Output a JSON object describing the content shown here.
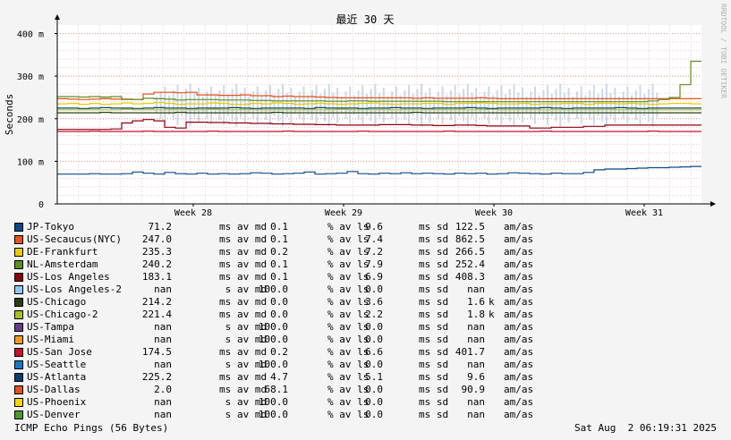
{
  "chart_data": {
    "type": "line",
    "title": "最近 30 天",
    "ylabel": "Seconds",
    "ylim": [
      0,
      0.42
    ],
    "y_ticks": [
      {
        "value": 0,
        "label": "0"
      },
      {
        "value": 0.1,
        "label": "100 m"
      },
      {
        "value": 0.2,
        "label": "200 m"
      },
      {
        "value": 0.3,
        "label": "300 m"
      },
      {
        "value": 0.4,
        "label": "400 m"
      }
    ],
    "x_ticks": [
      "Week 28",
      "Week 29",
      "Week 30",
      "Week 31"
    ],
    "grid": true,
    "watermark": "RRDTOOL / TOBI OETIKER",
    "series": [
      {
        "name": "JP-Tokyo",
        "color": "#0b4a8a",
        "values": [
          0.07,
          0.07,
          0.07,
          0.071,
          0.07,
          0.07,
          0.071,
          0.075,
          0.072,
          0.07,
          0.074,
          0.071,
          0.07,
          0.072,
          0.07,
          0.071,
          0.07,
          0.071,
          0.073,
          0.072,
          0.07,
          0.071,
          0.072,
          0.075,
          0.07,
          0.071,
          0.072,
          0.076,
          0.071,
          0.07,
          0.072,
          0.071,
          0.073,
          0.071,
          0.072,
          0.071,
          0.07,
          0.072,
          0.071,
          0.072,
          0.07,
          0.071,
          0.073,
          0.072,
          0.071,
          0.07,
          0.072,
          0.071,
          0.071,
          0.074,
          0.08,
          0.082,
          0.082,
          0.083,
          0.084,
          0.085,
          0.085,
          0.086,
          0.087,
          0.088
        ]
      },
      {
        "name": "US-Secaucus(NYC)",
        "color": "#e8511c",
        "values": [
          0.247,
          0.246,
          0.245,
          0.246,
          0.247,
          0.246,
          0.246,
          0.245,
          0.258,
          0.262,
          0.262,
          0.261,
          0.262,
          0.256,
          0.256,
          0.255,
          0.255,
          0.256,
          0.254,
          0.254,
          0.252,
          0.253,
          0.252,
          0.252,
          0.251,
          0.25,
          0.249,
          0.249,
          0.249,
          0.249,
          0.249,
          0.249,
          0.249,
          0.248,
          0.249,
          0.248,
          0.248,
          0.248,
          0.248,
          0.249,
          0.248,
          0.247,
          0.247,
          0.247,
          0.247,
          0.247,
          0.247,
          0.247,
          0.247,
          0.247,
          0.247,
          0.247,
          0.247,
          0.247,
          0.247,
          0.247,
          0.247,
          0.247,
          0.247,
          0.247
        ]
      },
      {
        "name": "DE-Frankfurt",
        "color": "#e8cc00",
        "values": [
          0.235,
          0.236,
          0.234,
          0.236,
          0.234,
          0.235,
          0.237,
          0.235,
          0.236,
          0.238,
          0.236,
          0.234,
          0.235,
          0.235,
          0.237,
          0.236,
          0.234,
          0.234,
          0.236,
          0.235,
          0.237,
          0.236,
          0.234,
          0.235,
          0.236,
          0.235,
          0.234,
          0.235,
          0.236,
          0.237,
          0.235,
          0.234,
          0.235,
          0.235,
          0.236,
          0.236,
          0.234,
          0.236,
          0.236,
          0.237,
          0.236,
          0.235,
          0.235,
          0.236,
          0.234,
          0.235,
          0.235,
          0.236,
          0.236,
          0.234,
          0.236,
          0.236,
          0.235,
          0.236,
          0.235,
          0.234,
          0.235,
          0.236,
          0.236,
          0.235
        ]
      },
      {
        "name": "NL-Amsterdam",
        "color": "#5b8f22",
        "values": [
          0.252,
          0.252,
          0.251,
          0.252,
          0.251,
          0.252,
          0.245,
          0.245,
          0.248,
          0.247,
          0.246,
          0.244,
          0.245,
          0.245,
          0.245,
          0.244,
          0.244,
          0.244,
          0.243,
          0.243,
          0.242,
          0.242,
          0.242,
          0.242,
          0.242,
          0.241,
          0.241,
          0.242,
          0.242,
          0.241,
          0.241,
          0.241,
          0.241,
          0.241,
          0.241,
          0.241,
          0.24,
          0.24,
          0.24,
          0.24,
          0.24,
          0.24,
          0.24,
          0.24,
          0.24,
          0.24,
          0.24,
          0.24,
          0.24,
          0.24,
          0.24,
          0.24,
          0.24,
          0.24,
          0.24,
          0.242,
          0.245,
          0.25,
          0.28,
          0.335
        ]
      },
      {
        "name": "US-Los Angeles",
        "color": "#8b0010",
        "values": [
          0.175,
          0.175,
          0.175,
          0.175,
          0.175,
          0.176,
          0.19,
          0.195,
          0.198,
          0.195,
          0.18,
          0.178,
          0.192,
          0.192,
          0.191,
          0.191,
          0.19,
          0.19,
          0.189,
          0.189,
          0.188,
          0.188,
          0.187,
          0.187,
          0.186,
          0.186,
          0.185,
          0.185,
          0.185,
          0.185,
          0.186,
          0.186,
          0.186,
          0.185,
          0.185,
          0.184,
          0.184,
          0.185,
          0.185,
          0.184,
          0.183,
          0.183,
          0.183,
          0.183,
          0.178,
          0.178,
          0.18,
          0.18,
          0.18,
          0.182,
          0.182,
          0.185,
          0.185,
          0.185,
          0.185,
          0.185,
          0.185,
          0.185,
          0.185,
          0.185
        ]
      },
      {
        "name": "US-Los Angeles-2",
        "color": "#8ec7ef",
        "values": [
          null
        ]
      },
      {
        "name": "US-Chicago",
        "color": "#2c3d12",
        "values": [
          0.214,
          0.214,
          0.214,
          0.214,
          0.215,
          0.214,
          0.214,
          0.214,
          0.214,
          0.214,
          0.214,
          0.215,
          0.214,
          0.214,
          0.214,
          0.214,
          0.214,
          0.214,
          0.214,
          0.214,
          0.215,
          0.214,
          0.214,
          0.214,
          0.214,
          0.214,
          0.214,
          0.214,
          0.214,
          0.214,
          0.214,
          0.214,
          0.214,
          0.215,
          0.214,
          0.214,
          0.214,
          0.214,
          0.214,
          0.214,
          0.214,
          0.214,
          0.214,
          0.214,
          0.214,
          0.214,
          0.214,
          0.214,
          0.214,
          0.214,
          0.214,
          0.214,
          0.214,
          0.214,
          0.214,
          0.214,
          0.214,
          0.214,
          0.214,
          0.214
        ]
      },
      {
        "name": "US-Chicago-2",
        "color": "#a8c21a",
        "values": [
          0.221,
          0.221,
          0.221,
          0.221,
          0.221,
          0.221,
          0.222,
          0.221,
          0.221,
          0.221,
          0.221,
          0.221,
          0.221,
          0.221,
          0.222,
          0.221,
          0.221,
          0.221,
          0.221,
          0.221,
          0.221,
          0.221,
          0.221,
          0.221,
          0.221,
          0.221,
          0.222,
          0.221,
          0.221,
          0.221,
          0.221,
          0.221,
          0.221,
          0.221,
          0.221,
          0.221,
          0.221,
          0.221,
          0.221,
          0.221,
          0.222,
          0.221,
          0.221,
          0.221,
          0.221,
          0.221,
          0.221,
          0.221,
          0.221,
          0.221,
          0.221,
          0.221,
          0.221,
          0.221,
          0.221,
          0.221,
          0.221,
          0.221,
          0.221,
          0.221
        ]
      },
      {
        "name": "US-Tampa",
        "color": "#6a3a8a",
        "values": [
          null
        ]
      },
      {
        "name": "US-Miami",
        "color": "#f39a1c",
        "values": [
          null
        ]
      },
      {
        "name": "US-San Jose",
        "color": "#c8102e",
        "values": [
          0.17,
          0.17,
          0.17,
          0.171,
          0.17,
          0.17,
          0.17,
          0.17,
          0.171,
          0.17,
          0.17,
          0.17,
          0.17,
          0.17,
          0.171,
          0.17,
          0.17,
          0.17,
          0.17,
          0.17,
          0.17,
          0.171,
          0.17,
          0.17,
          0.17,
          0.17,
          0.17,
          0.17,
          0.171,
          0.17,
          0.17,
          0.17,
          0.17,
          0.17,
          0.17,
          0.17,
          0.171,
          0.17,
          0.17,
          0.17,
          0.17,
          0.17,
          0.17,
          0.17,
          0.17,
          0.171,
          0.17,
          0.17,
          0.17,
          0.17,
          0.17,
          0.17,
          0.17,
          0.17,
          0.17,
          0.171,
          0.17,
          0.17,
          0.17,
          0.17
        ]
      },
      {
        "name": "US-Seattle",
        "color": "#1a78c8",
        "values": [
          null
        ]
      },
      {
        "name": "US-Atlanta",
        "color": "#0a3e73",
        "values": [
          0.225,
          0.225,
          0.224,
          0.225,
          0.226,
          0.225,
          0.225,
          0.224,
          0.225,
          0.226,
          0.225,
          0.225,
          0.224,
          0.225,
          0.225,
          0.225,
          0.226,
          0.225,
          0.224,
          0.225,
          0.225,
          0.225,
          0.225,
          0.224,
          0.226,
          0.225,
          0.225,
          0.225,
          0.224,
          0.225,
          0.225,
          0.226,
          0.225,
          0.225,
          0.224,
          0.225,
          0.225,
          0.225,
          0.226,
          0.225,
          0.224,
          0.225,
          0.225,
          0.225,
          0.225,
          0.226,
          0.225,
          0.224,
          0.225,
          0.225,
          0.225,
          0.225,
          0.226,
          0.225,
          0.224,
          0.225,
          0.225,
          0.225,
          0.225,
          0.225
        ]
      },
      {
        "name": "US-Dallas",
        "color": "#e8511c",
        "values": [
          null
        ]
      },
      {
        "name": "US-Phoenix",
        "color": "#ffd700",
        "values": [
          null
        ]
      },
      {
        "name": "US-Denver",
        "color": "#4a9a2a",
        "values": [
          null
        ]
      }
    ]
  },
  "legend": [
    {
      "name": "JP-Tokyo",
      "avg": "71.2",
      "avg_unit": "ms",
      "loss": "0.1",
      "sd": "9.6",
      "amas": "122.5",
      "amas_unit": ""
    },
    {
      "name": "US-Secaucus(NYC)",
      "avg": "247.0",
      "avg_unit": "ms",
      "loss": "0.1",
      "sd": "7.4",
      "amas": "862.5",
      "amas_unit": ""
    },
    {
      "name": "DE-Frankfurt",
      "avg": "235.3",
      "avg_unit": "ms",
      "loss": "0.2",
      "sd": "7.2",
      "amas": "266.5",
      "amas_unit": ""
    },
    {
      "name": "NL-Amsterdam",
      "avg": "240.2",
      "avg_unit": "ms",
      "loss": "0.1",
      "sd": "7.9",
      "amas": "252.4",
      "amas_unit": ""
    },
    {
      "name": "US-Los Angeles",
      "avg": "183.1",
      "avg_unit": "ms",
      "loss": "0.1",
      "sd": "6.9",
      "amas": "408.3",
      "amas_unit": ""
    },
    {
      "name": "US-Los Angeles-2",
      "avg": "nan",
      "avg_unit": " s",
      "loss": "100.0",
      "sd": "0.0",
      "amas": "nan",
      "amas_unit": ""
    },
    {
      "name": "US-Chicago",
      "avg": "214.2",
      "avg_unit": "ms",
      "loss": "0.0",
      "sd": "3.6",
      "amas": "1.6",
      "amas_unit": "k"
    },
    {
      "name": "US-Chicago-2",
      "avg": "221.4",
      "avg_unit": "ms",
      "loss": "0.0",
      "sd": "2.2",
      "amas": "1.8",
      "amas_unit": "k"
    },
    {
      "name": "US-Tampa",
      "avg": "nan",
      "avg_unit": " s",
      "loss": "100.0",
      "sd": "0.0",
      "amas": "nan",
      "amas_unit": ""
    },
    {
      "name": "US-Miami",
      "avg": "nan",
      "avg_unit": " s",
      "loss": "100.0",
      "sd": "0.0",
      "amas": "nan",
      "amas_unit": ""
    },
    {
      "name": "US-San Jose",
      "avg": "174.5",
      "avg_unit": "ms",
      "loss": "0.2",
      "sd": "6.6",
      "amas": "401.7",
      "amas_unit": ""
    },
    {
      "name": "US-Seattle",
      "avg": "nan",
      "avg_unit": " s",
      "loss": "100.0",
      "sd": "0.0",
      "amas": "nan",
      "amas_unit": ""
    },
    {
      "name": "US-Atlanta",
      "avg": "225.2",
      "avg_unit": "ms",
      "loss": "4.7",
      "sd": "5.1",
      "amas": "9.6",
      "amas_unit": ""
    },
    {
      "name": "US-Dallas",
      "avg": "2.0",
      "avg_unit": "ms",
      "loss": "68.1",
      "sd": "0.0",
      "amas": "90.9",
      "amas_unit": ""
    },
    {
      "name": "US-Phoenix",
      "avg": "nan",
      "avg_unit": " s",
      "loss": "100.0",
      "sd": "0.0",
      "amas": "nan",
      "amas_unit": ""
    },
    {
      "name": "US-Denver",
      "avg": "nan",
      "avg_unit": " s",
      "loss": "100.0",
      "sd": "0.0",
      "amas": "nan",
      "amas_unit": ""
    }
  ],
  "labels": {
    "av_md": "av md",
    "av_ls": "% av ls",
    "ms_sd": "ms sd",
    "am_as": "am/as"
  },
  "footer": {
    "left": "ICMP Echo Pings (56 Bytes)",
    "right": "Sat Aug  2 06:19:31 2025"
  }
}
